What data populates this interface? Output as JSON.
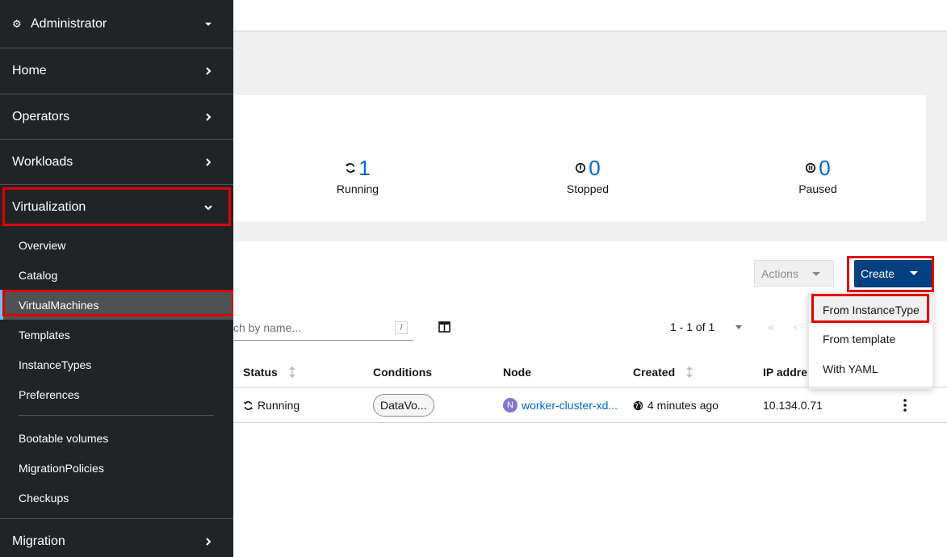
{
  "sidebar": {
    "perspective": "Administrator",
    "sections": {
      "home": "Home",
      "operators": "Operators",
      "workloads": "Workloads",
      "virtualization": "Virtualization",
      "migration": "Migration"
    },
    "virtualization_items": {
      "overview": "Overview",
      "catalog": "Catalog",
      "virtualmachines": "VirtualMachines",
      "templates": "Templates",
      "instancetypes": "InstanceTypes",
      "preferences": "Preferences",
      "bootable_volumes": "Bootable volumes",
      "migrationpolicies": "MigrationPolicies",
      "checkups": "Checkups"
    }
  },
  "status_summary": {
    "running": {
      "value": "1",
      "label": "Running"
    },
    "stopped": {
      "value": "0",
      "label": "Stopped"
    },
    "paused": {
      "value": "0",
      "label": "Paused"
    }
  },
  "toolbar": {
    "actions_label": "Actions",
    "create_label": "Create",
    "create_menu": {
      "from_instancetype": "From InstanceType",
      "from_template": "From template",
      "with_yaml": "With YAML"
    },
    "search_placeholder": "ch by name...",
    "search_shortcut": "/",
    "pagination": "1 - 1 of 1"
  },
  "table": {
    "columns": {
      "status": "Status",
      "conditions": "Conditions",
      "node": "Node",
      "created": "Created",
      "ip": "IP addre"
    },
    "row": {
      "status": "Running",
      "condition": "DataVo...",
      "node_badge": "N",
      "node": "worker-cluster-xd...",
      "created": "4 minutes ago",
      "ip": "10.134.0.71"
    }
  },
  "colors": {
    "sidebar_bg": "#212427",
    "accent": "#0066cc",
    "create_button": "#004080",
    "highlight": "#e00000"
  }
}
